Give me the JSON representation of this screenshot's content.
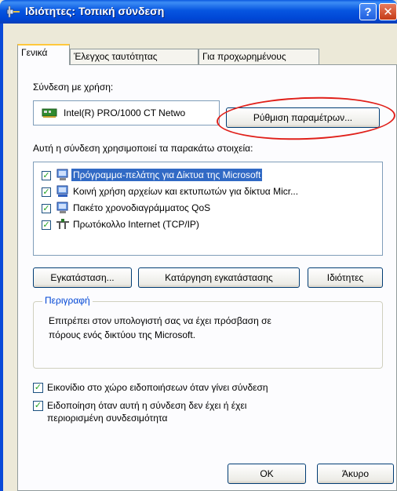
{
  "window": {
    "title": "Ιδιότητες: Τοπική σύνδεση",
    "help_label": "?",
    "close_label": "✕"
  },
  "tabs": [
    {
      "label": "Γενικά"
    },
    {
      "label": "Έλεγχος ταυτότητας"
    },
    {
      "label": "Για προχωρημένους"
    }
  ],
  "general": {
    "connect_using_label": "Σύνδεση με χρήση:",
    "adapter_name": "Intel(R) PRO/1000 CT Netwo",
    "configure_button": "Ρύθμιση παραμέτρων...",
    "components_label": "Αυτή η σύνδεση χρησιμοποιεί τα παρακάτω στοιχεία:",
    "components": [
      {
        "label": "Πρόγραμμα-πελάτης για Δίκτυα της Microsoft",
        "checked": true,
        "icon": "network-client-icon"
      },
      {
        "label": "Κοινή χρήση αρχείων και εκτυπωτών για δίκτυα Micr...",
        "checked": true,
        "icon": "file-printer-sharing-icon"
      },
      {
        "label": "Πακέτο χρονοδιαγράμματος QoS",
        "checked": true,
        "icon": "qos-scheduler-icon"
      },
      {
        "label": "Πρωτόκολλο Internet (TCP/IP)",
        "checked": true,
        "icon": "protocol-icon"
      }
    ],
    "install_button": "Εγκατάσταση...",
    "uninstall_button": "Κατάργηση εγκατάστασης",
    "properties_button": "Ιδιότητες",
    "description_title": "Περιγραφή",
    "description_line1": "Επιτρέπει στον υπολογιστή σας να έχει πρόσβαση σε",
    "description_line2": "πόρους ενός δικτύου της Microsoft.",
    "show_icon_label": "Εικονίδιο στο χώρο ειδοποιήσεων όταν γίνει σύνδεση",
    "show_icon_checked": true,
    "notify_label_line1": "Ειδοποίηση όταν αυτή η σύνδεση δεν έχει ή έχει",
    "notify_label_line2": "περιορισμένη συνδεσιμότητα",
    "notify_checked": true
  },
  "footer": {
    "ok_button": "OK",
    "cancel_button": "Άκυρο"
  },
  "colors": {
    "titlebar": "#0054e3",
    "selection": "#316ac5",
    "annotation": "#e0201a",
    "group_title": "#0046d5"
  }
}
